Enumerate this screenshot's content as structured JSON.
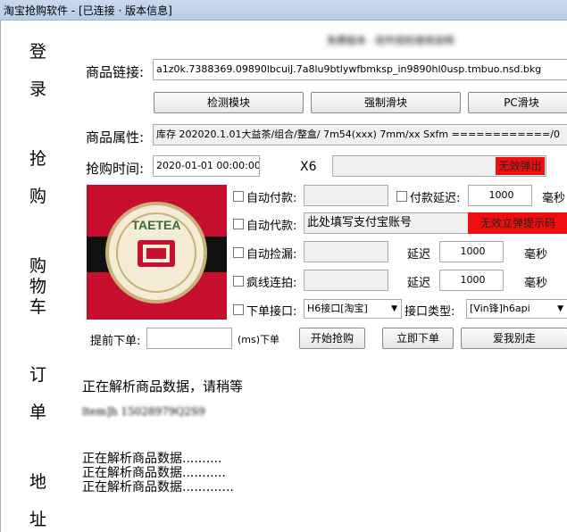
{
  "window": {
    "title": "淘宝抢购软件 - [已连接 · 版本信息]"
  },
  "nav": [
    "登",
    "录",
    "抢",
    "购",
    "购",
    "物",
    "车",
    "订",
    "单",
    "地",
    "址"
  ],
  "header_blur": "免费版本 · 软件授权使用说明",
  "product": {
    "link_label": "商品链接:",
    "link_value": "a1z0k.7388369.09890lbcuiJ.7a8lu9btlywfbmksp_in9890hl0usp.tmbuo.nsd.bkg",
    "attr_label": "商品属性:",
    "attr_value": "库存 202020.1.01大益茶/组合/整盒/ 7m54(xxx) 7mm/xx  Sxfm ============/0"
  },
  "buttons": {
    "detect": "检测模块",
    "slider": "强制滑块",
    "pc_slider": "PC滑块",
    "start": "开始抢购",
    "order_now": "立即下单",
    "bye": "爱我别走"
  },
  "time": {
    "label": "抢购时间:",
    "value": "2020-01-01 00:00:00",
    "multiplier": "X6"
  },
  "red_labels": {
    "popup": "无效弹出",
    "alipay_hint": "无效立弹提示码"
  },
  "options": {
    "auto_pay": "自动付款:",
    "pay_delay": "付款延迟:",
    "pay_delay_value": "1000",
    "ms": "毫秒",
    "auto_proxy": "自动代款:",
    "alipay_placeholder": "此处填写支付宝账号",
    "auto_pick": "自动捡漏:",
    "delay": "延迟",
    "pick_delay_value": "1000",
    "crazy": "疯线连拍:",
    "crazy_delay_value": "1000",
    "order_api": "下单接口:",
    "api_value": "H6接口[淘宝]",
    "api_type_label": "接口类型:",
    "api_type_value": "[Vin锋]h6api"
  },
  "advance": {
    "label": "提前下单:",
    "unit": "(ms)下单"
  },
  "output": {
    "line1": "正在解析商品数据，请稍等",
    "line2": "ltem]h 15028979Q2S9",
    "lines": [
      "正在解析商品数据..........",
      "正在解析商品数据...........",
      "正在解析商品数据............."
    ]
  },
  "colors": {
    "red": "#f00f0f",
    "logo_red": "#c8102e",
    "logo_black": "#111111"
  }
}
